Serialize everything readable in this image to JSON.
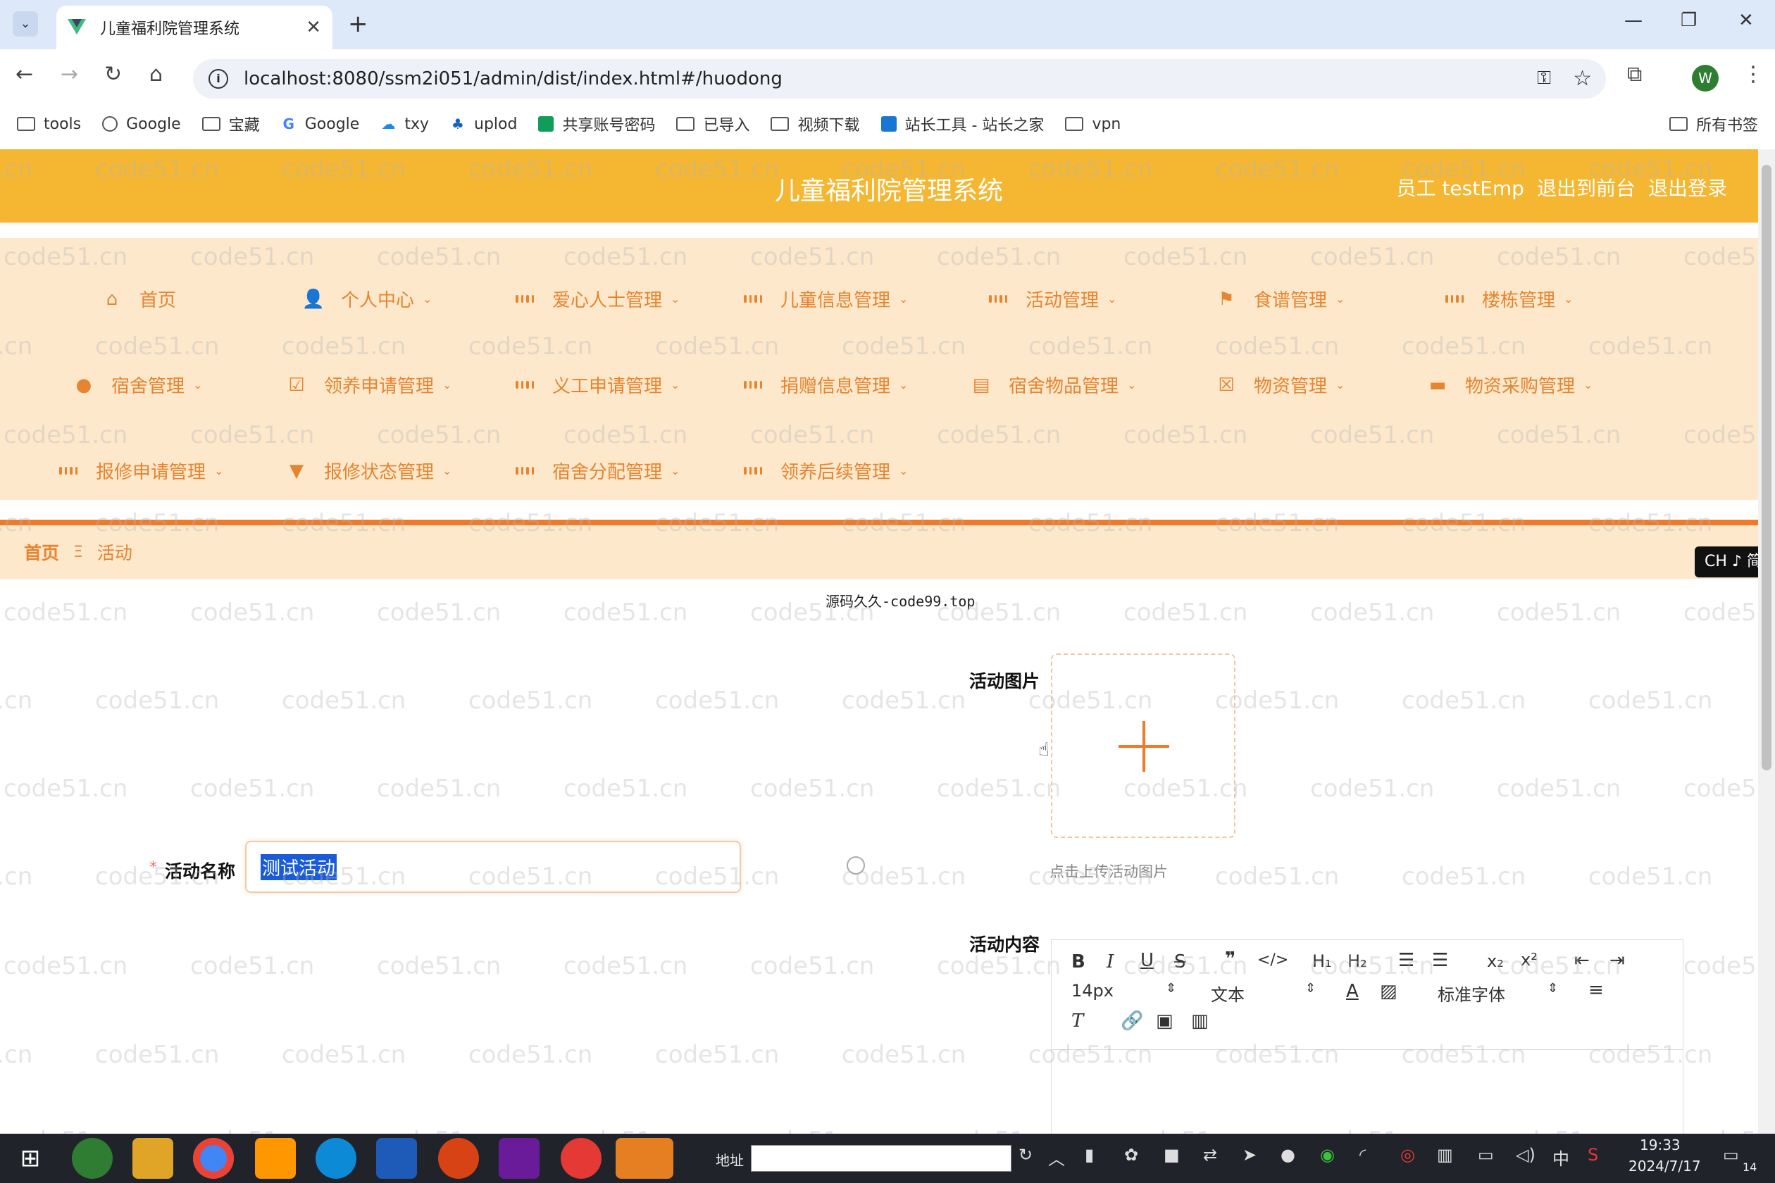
{
  "browser": {
    "tab_title": "儿童福利院管理系统",
    "url": "localhost:8080/ssm2i051/admin/dist/index.html#/huodong",
    "bookmarks": [
      "tools",
      "Google",
      "宝藏",
      "Google",
      "txy",
      "uplod",
      "共享账号密码",
      "已导入",
      "视频下载",
      "站长工具 - 站长之家",
      "vpn"
    ],
    "all_bookmarks": "所有书签",
    "profile_initial": "W"
  },
  "header": {
    "title": "儿童福利院管理系统",
    "user": "员工 testEmp",
    "to_front": "退出到前台",
    "logout": "退出登录"
  },
  "menu": {
    "row1": [
      "首页",
      "个人中心",
      "爱心人士管理",
      "儿童信息管理",
      "活动管理",
      "食谱管理",
      "楼栋管理"
    ],
    "row2": [
      "宿舍管理",
      "领养申请管理",
      "义工申请管理",
      "捐赠信息管理",
      "宿舍物品管理",
      "物资管理",
      "物资采购管理"
    ],
    "row3": [
      "报修申请管理",
      "报修状态管理",
      "宿舍分配管理",
      "领养后续管理"
    ]
  },
  "breadcrumb": {
    "home": "首页",
    "separator": "Ξ",
    "current": "活动"
  },
  "ime_badge": "CH ♪ 简",
  "note": "源码久久-code99.top",
  "form": {
    "image_label": "活动图片",
    "upload_hint": "点击上传活动图片",
    "name_label": "活动名称",
    "name_value": "测试活动",
    "content_label": "活动内容"
  },
  "editor": {
    "font_size": "14px",
    "format": "文本",
    "font_family": "标准字体"
  },
  "watermark": "code51.cn",
  "taskbar": {
    "address_label": "地址",
    "time": "19:33",
    "date": "2024/7/17",
    "ime": "中",
    "notifications": "14"
  }
}
